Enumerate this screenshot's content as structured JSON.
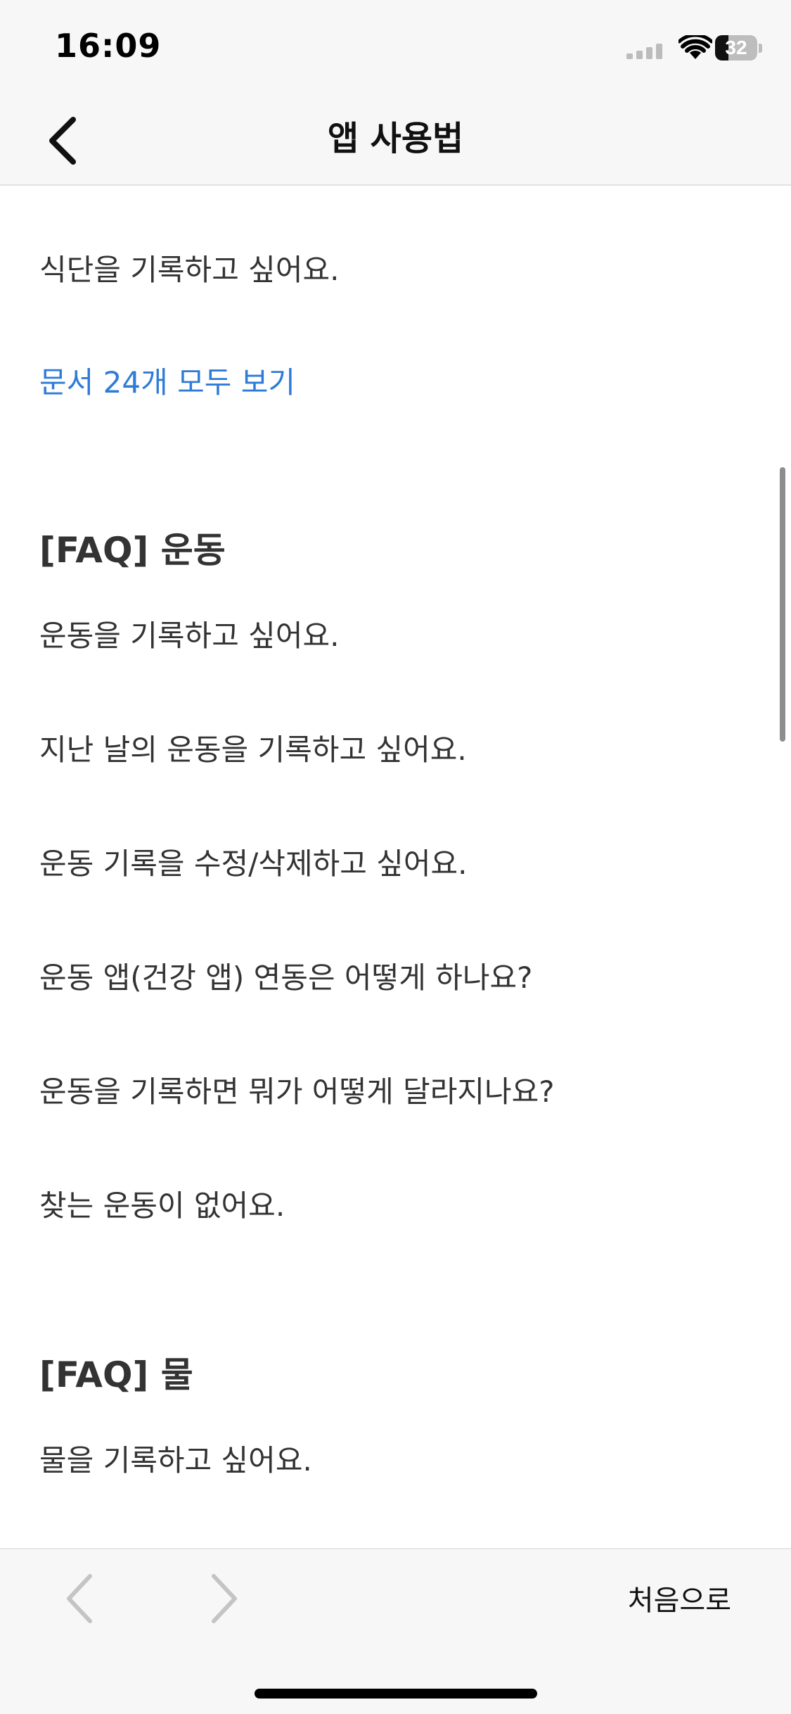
{
  "status_bar": {
    "time": "16:09",
    "battery_level": "32",
    "battery_fraction": 0.32,
    "icons": [
      "cellular-signal-icon",
      "wifi-icon",
      "battery-icon"
    ]
  },
  "nav": {
    "title": "앱 사용법",
    "back_icon": "chevron-left-icon"
  },
  "content": {
    "diet_last_item": "식단을 기록하고 싶어요.",
    "diet_view_all": "문서 24개 모두 보기",
    "exercise": {
      "heading": "[FAQ] 운동",
      "items": [
        "운동을 기록하고 싶어요.",
        "지난 날의 운동을 기록하고 싶어요.",
        "운동 기록을 수정/삭제하고 싶어요.",
        "운동 앱(건강 앱) 연동은 어떻게 하나요?",
        "운동을 기록하면 뭐가 어떻게 달라지나요?",
        "찾는 운동이 없어요."
      ]
    },
    "water": {
      "heading": "[FAQ] 물",
      "items": [
        "물을 기록하고 싶어요."
      ]
    }
  },
  "toolbar": {
    "prev_icon": "chevron-left-icon",
    "next_icon": "chevron-right-icon",
    "home_label": "처음으로"
  },
  "colors": {
    "link": "#2f7bd8",
    "text": "#333333",
    "bar_background": "#f7f7f7"
  }
}
